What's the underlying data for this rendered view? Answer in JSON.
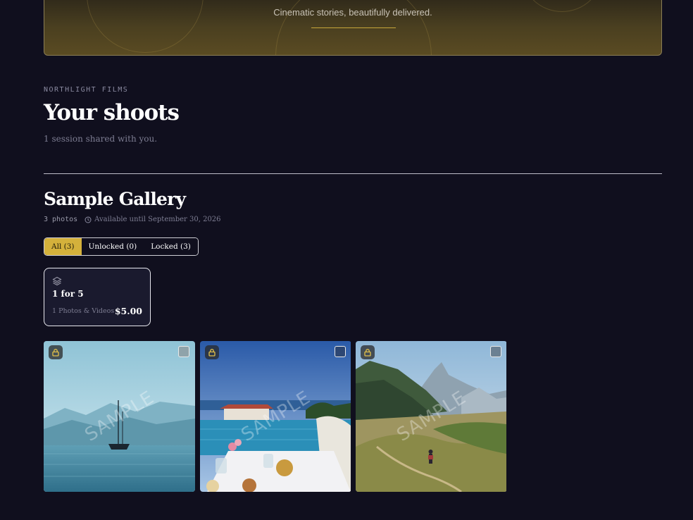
{
  "hero": {
    "tagline": "Cinematic stories, beautifully delivered."
  },
  "header": {
    "eyebrow": "NORTHLIGHT FILMS",
    "title": "Your shoots",
    "subtitle": "1 session shared with you."
  },
  "gallery": {
    "title": "Sample Gallery",
    "photo_count": "3 photos",
    "availability": "Available until September 30, 2026",
    "filters": [
      {
        "label": "All (3)",
        "active": true
      },
      {
        "label": "Unlocked (0)",
        "active": false
      },
      {
        "label": "Locked (3)",
        "active": false
      }
    ],
    "package": {
      "icon": "layers-icon",
      "name": "1 for 5",
      "description": "1 Photos & Videos",
      "price": "$5.00"
    },
    "watermark_text": "SAMPLE",
    "photos": [
      {
        "subject": "sailboat-on-lake",
        "locked": true,
        "selected": false
      },
      {
        "subject": "infinity-pool-breakfast",
        "locked": true,
        "selected": false
      },
      {
        "subject": "mountain-hiker",
        "locked": true,
        "selected": false
      }
    ]
  },
  "colors": {
    "background": "#100f1e",
    "accent": "#d4b13b",
    "card": "#1a1a2e",
    "muted": "#7d7d92"
  }
}
